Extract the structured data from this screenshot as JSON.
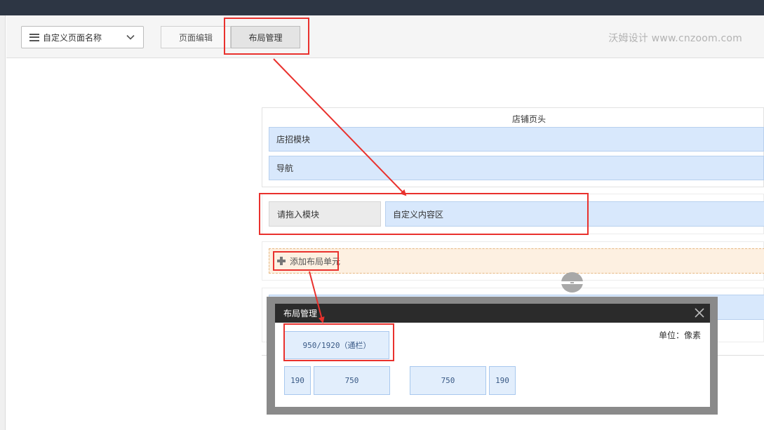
{
  "toolbar": {
    "page_select": "自定义页面名称",
    "tab_page_edit": "页面编辑",
    "tab_layout_mgmt": "布局管理",
    "watermark": "沃姆设计 www.cnzoom.com"
  },
  "layout": {
    "header_title": "店铺页头",
    "sign_module": "店招模块",
    "nav": "导航",
    "drop_zone": "请拖入模块",
    "custom_area": "自定义内容区",
    "add_unit": "添加布局单元"
  },
  "dialog": {
    "title": "布局管理",
    "unit_label": "单位：像素",
    "full_width_option": "950/1920（通栏）",
    "left_sidebar_option": [
      "190",
      "750"
    ],
    "right_sidebar_option": [
      "750",
      "190"
    ]
  },
  "colors": {
    "highlight": "#e9312d",
    "module_blue": "#d8e8fc",
    "topbar": "#2d3644"
  }
}
